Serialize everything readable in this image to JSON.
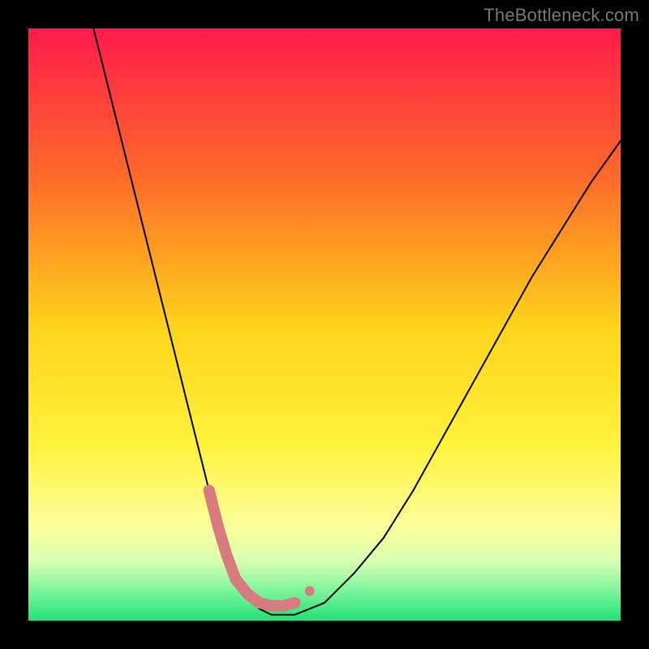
{
  "watermark": "TheBottleneck.com",
  "chart_data": {
    "type": "line",
    "title": "",
    "xlabel": "",
    "ylabel": "",
    "xlim": [
      0,
      100
    ],
    "ylim": [
      0,
      100
    ],
    "background_gradient_stops": [
      {
        "offset": 0,
        "color": "#ff1a4b"
      },
      {
        "offset": 25,
        "color": "#ff6a2a"
      },
      {
        "offset": 50,
        "color": "#ffd21a"
      },
      {
        "offset": 70,
        "color": "#fff23a"
      },
      {
        "offset": 84,
        "color": "#fdff9a"
      },
      {
        "offset": 90,
        "color": "#d7ffb0"
      },
      {
        "offset": 95,
        "color": "#7cf59a"
      },
      {
        "offset": 100,
        "color": "#22e07a"
      }
    ],
    "series": [
      {
        "name": "bottleneck-curve",
        "stroke": "#000000",
        "stroke_width": 2,
        "x": [
          11,
          13,
          15,
          17,
          19,
          21,
          23,
          25,
          27,
          29,
          30.5,
          32,
          33.5,
          35,
          37,
          39,
          41,
          45,
          50,
          55,
          60,
          65,
          70,
          75,
          80,
          85,
          90,
          95,
          100
        ],
        "y": [
          100,
          92,
          84,
          76,
          68,
          60,
          52,
          44,
          36,
          28,
          22,
          16,
          11,
          7,
          4,
          2,
          1,
          1,
          3,
          8,
          14,
          22,
          31,
          40,
          49,
          58,
          66,
          74,
          81
        ]
      }
    ],
    "highlight_band": {
      "name": "optimal-range",
      "color": "#d97a7e",
      "stroke_width": 14,
      "linecap": "round",
      "x": [
        30.5,
        32,
        33.5,
        35,
        37,
        39,
        41,
        43,
        45
      ],
      "y": [
        22,
        16,
        11,
        7,
        4.5,
        3,
        2.5,
        2.5,
        3
      ]
    },
    "highlight_dot": {
      "name": "secondary-marker",
      "color": "#d97a7e",
      "radius": 6,
      "x": 47.5,
      "y": 5
    }
  }
}
